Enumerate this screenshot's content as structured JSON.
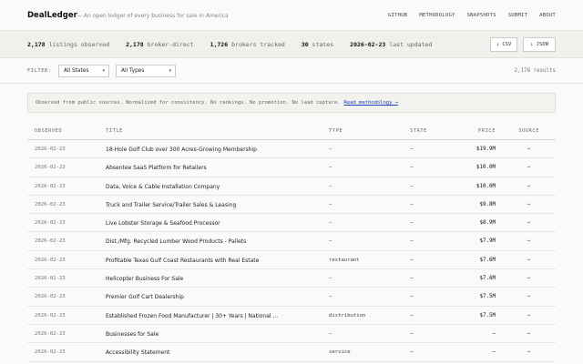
{
  "header": {
    "brand": "DealLedger",
    "tagline": "— An open ledger of every business for sale in America",
    "nav": [
      "GITHUB",
      "METHODOLOGY",
      "SNAPSHOTS",
      "SUBMIT",
      "ABOUT"
    ]
  },
  "stats": [
    {
      "value": "2,178",
      "label": "listings observed"
    },
    {
      "value": "2,178",
      "label": "broker-direct"
    },
    {
      "value": "1,726",
      "label": "brokers tracked"
    },
    {
      "value": "30",
      "label": "states"
    },
    {
      "value": "2026-02-23",
      "label": "last updated"
    }
  ],
  "export": {
    "csv": "↓ CSV",
    "json": "↓ JSON"
  },
  "filters": {
    "label": "FILTER:",
    "state_selected": "All States",
    "type_selected": "All Types",
    "results": "2,178 results"
  },
  "notice": {
    "text": "Observed from public sources. Normalized for consistency. No rankings. No promotion. No lead capture.",
    "link": "Read methodology →"
  },
  "table": {
    "columns": [
      "OBSERVED",
      "TITLE",
      "TYPE",
      "STATE",
      "PRICE",
      "SOURCE"
    ],
    "rows": [
      {
        "observed": "2026-02-23",
        "title": "18-Hole Golf Club over 300 Acres-Growing Membership",
        "type": "—",
        "state": "—",
        "price": "$19.9M",
        "source": "→"
      },
      {
        "observed": "2026-02-23",
        "title": "Absentee SaaS Platform for Retailers",
        "type": "—",
        "state": "—",
        "price": "$10.0M",
        "source": "→"
      },
      {
        "observed": "2026-02-23",
        "title": "Data, Voice & Cable Installation Company",
        "type": "—",
        "state": "—",
        "price": "$10.0M",
        "source": "→"
      },
      {
        "observed": "2026-02-23",
        "title": "Truck and Trailer Service/Trailer Sales & Leasing",
        "type": "—",
        "state": "—",
        "price": "$9.8M",
        "source": "→"
      },
      {
        "observed": "2026-02-23",
        "title": "Live Lobster Storage & Seafood Processor",
        "type": "—",
        "state": "—",
        "price": "$8.9M",
        "source": "→"
      },
      {
        "observed": "2026-02-23",
        "title": "Dist./Mfg. Recycled Lumber Wood Products - Pallets",
        "type": "—",
        "state": "—",
        "price": "$7.9M",
        "source": "→"
      },
      {
        "observed": "2026-02-23",
        "title": "Profitable Texas Gulf Coast Restaurants with Real Estate",
        "type": "restaurant",
        "state": "—",
        "price": "$7.6M",
        "source": "→"
      },
      {
        "observed": "2026-02-23",
        "title": "Helicopter Business For Sale",
        "type": "—",
        "state": "—",
        "price": "$7.6M",
        "source": "→"
      },
      {
        "observed": "2026-02-23",
        "title": "Premier Golf Cart Dealership",
        "type": "—",
        "state": "—",
        "price": "$7.5M",
        "source": "→"
      },
      {
        "observed": "2026-02-23",
        "title": "Established Frozen Food Manufacturer | 30+ Years | National ...",
        "type": "distribution",
        "state": "—",
        "price": "$7.5M",
        "source": "→"
      },
      {
        "observed": "2026-02-23",
        "title": "Businesses for Sale",
        "type": "—",
        "state": "—",
        "price": "—",
        "source": "→"
      },
      {
        "observed": "2026-02-23",
        "title": "Accessibility Statement",
        "type": "service",
        "state": "—",
        "price": "—",
        "source": "→"
      }
    ]
  }
}
